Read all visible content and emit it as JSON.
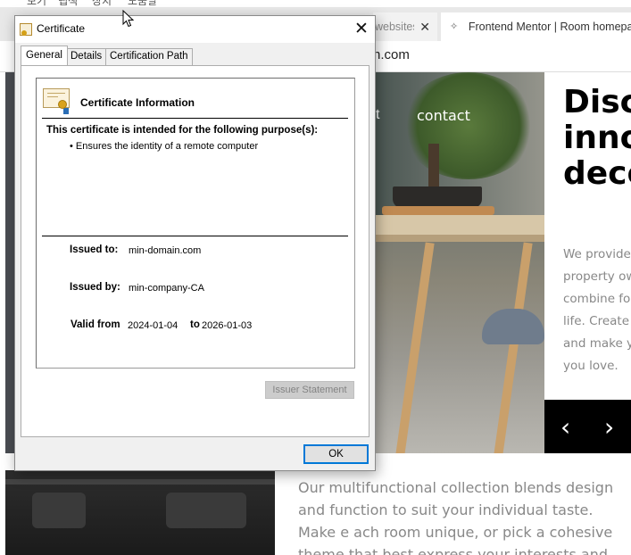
{
  "browser": {
    "menu_items": [
      "보기",
      "탭색",
      "장치",
      "도움말"
    ],
    "tabs": [
      {
        "label": "websites",
        "close_glyph": "✕"
      },
      {
        "label": "Frontend Mentor | Room homepage",
        "favicon_glyph": "✧"
      }
    ],
    "url_fragment": "n.com"
  },
  "website": {
    "nav_partial": "t",
    "nav_contact": "contact",
    "hero_title": "Disc\ninno\ndeco",
    "hero_body": "We provide\nproperty ow\ncombine for\nlife. Create a\nand make yo\nyou love.",
    "slider_prev": "‹",
    "slider_next": "›",
    "about_text": "Our multifunctional collection blends design and function to suit your individual taste. Make e ach room unique, or pick a cohesive theme that best express your interests and"
  },
  "dialog": {
    "title": "Certificate",
    "close_glyph": "✕",
    "tabs": [
      "General",
      "Details",
      "Certification Path"
    ],
    "info_heading": "Certificate Information",
    "purpose_heading": "This certificate is intended for the following purpose(s):",
    "purposes": [
      "• Ensures the identity of a remote computer"
    ],
    "issued_to_label": "Issued to:",
    "issued_to": "min-domain.com",
    "issued_by_label": "Issued by:",
    "issued_by": "min-company-CA",
    "valid_from_label": "Valid from",
    "valid_from": "2024-01-04",
    "valid_to_label": "to",
    "valid_to": "2026-01-03",
    "issuer_statement_label": "Issuer Statement",
    "ok_label": "OK"
  },
  "colors": {
    "focus_blue": "#0078d7",
    "dialog_bg": "#f0f0f0",
    "disabled_text": "#838383"
  }
}
